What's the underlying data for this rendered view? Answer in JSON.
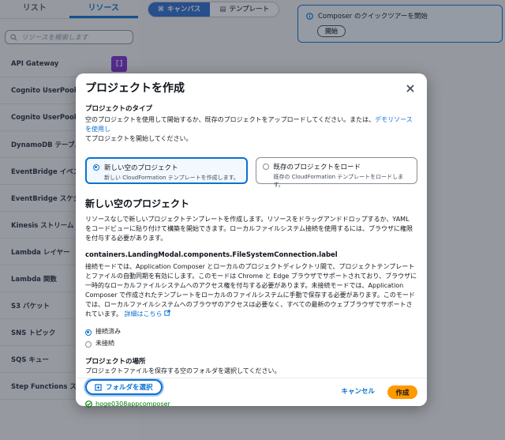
{
  "sidebar": {
    "tabs": [
      {
        "label": "リスト",
        "active": false
      },
      {
        "label": "リソース",
        "active": true
      }
    ],
    "search_placeholder": "リソースを検索します",
    "items": [
      {
        "label": "API Gateway"
      },
      {
        "label": "Cognito UserPool"
      },
      {
        "label": "Cognito UserPoolClient"
      },
      {
        "label": "DynamoDB テーブル"
      },
      {
        "label": "EventBridge イベントル"
      },
      {
        "label": "EventBridge スケジュー"
      },
      {
        "label": "Kinesis ストリーム"
      },
      {
        "label": "Lambda レイヤー"
      },
      {
        "label": "Lambda 関数"
      },
      {
        "label": "S3 バケット"
      },
      {
        "label": "SNS トピック"
      },
      {
        "label": "SQS キュー"
      },
      {
        "label": "Step Functions ステー"
      }
    ]
  },
  "toolbar": {
    "canvas_label": "キャンバス",
    "template_label": "テンプレート"
  },
  "tour": {
    "title": "Composer のクイックツアーを開始",
    "start_label": "開始"
  },
  "modal": {
    "title": "プロジェクトを作成",
    "type_heading": "プロジェクトのタイプ",
    "type_desc_1": "空のプロジェクトを使用して開始するか、既存のプロジェクトをアップロードしてください。または、",
    "type_desc_link": "デモリソースを使用し",
    "type_desc_2": "てプロジェクトを開始してください。",
    "tiles": [
      {
        "title": "新しい空のプロジェクト",
        "desc": "新しい CloudFormation テンプレートを作成します。",
        "selected": true
      },
      {
        "title": "既存のプロジェクトをロード",
        "desc": "既存の CloudFormation テンプレートをロードします。",
        "selected": false
      }
    ],
    "section_title": "新しい空のプロジェクト",
    "section_desc": "リソースなしで新しいプロジェクトテンプレートを作成します。リソースをドラッグアンドドロップするか、YAML をコードビューに貼り付けて構築を開始できます。ローカルファイルシステム接続を使用するには、ブラウザに権限を付与する必要があります。",
    "connection_label": "containers.LandingModal.components.FileSystemConnection.label",
    "connection_desc": "接続モードでは、Application Composer とローカルのプロジェクトディレクトリ間で、プロジェクトテンプレートとファイルの自動同期を有効にします。このモードは Chrome と Edge ブラウザでサポートされており、ブラウザに一時的なローカルファイルシステムへのアクセス権を付与する必要があります。未接続モードでは、Application Composer で作成されたテンプレートをローカルのファイルシステムに手動で保存する必要があります。このモードでは、ローカルファイルシステムへのブラウザのアクセスは必要なく、すべての最新のウェブブラウザでサポートされています。",
    "learn_more": "詳細はこちら",
    "modes": [
      {
        "label": "接続済み",
        "selected": true
      },
      {
        "label": "未接続",
        "selected": false
      }
    ],
    "location_heading": "プロジェクトの場所",
    "location_desc": "プロジェクトファイルを保存する空のフォルダを選択してください。",
    "select_folder_label": "フォルダを選択",
    "selected_folder": "hoge0308appcomposer",
    "cancel_label": "キャンセル",
    "create_label": "作成"
  },
  "colors": {
    "accent": "#0972d3",
    "primary_button": "#ff9900",
    "success": "#037f0c",
    "component_badge": "#7b2fd1"
  }
}
